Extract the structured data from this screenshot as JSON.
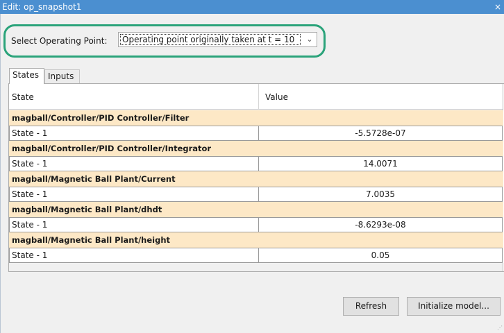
{
  "window": {
    "title": "Edit: op_snapshot1",
    "close_glyph": "×"
  },
  "operating_point": {
    "label": "Select Operating Point:",
    "selected": "Operating point originally taken at t = 10",
    "chevron": "⌄"
  },
  "tabs": [
    {
      "label": "States",
      "active": true
    },
    {
      "label": "Inputs",
      "active": false
    }
  ],
  "table": {
    "columns": [
      "State",
      "Value"
    ],
    "groups": [
      {
        "name": "magball/Controller/PID Controller/Filter",
        "state": "State - 1",
        "value": "-5.5728e-07"
      },
      {
        "name": "magball/Controller/PID Controller/Integrator",
        "state": "State - 1",
        "value": "14.0071"
      },
      {
        "name": "magball/Magnetic Ball Plant/Current",
        "state": "State - 1",
        "value": "7.0035"
      },
      {
        "name": "magball/Magnetic Ball Plant/dhdt",
        "state": "State - 1",
        "value": "-8.6293e-08"
      },
      {
        "name": "magball/Magnetic Ball Plant/height",
        "state": "State - 1",
        "value": "0.05"
      }
    ]
  },
  "buttons": {
    "refresh": "Refresh",
    "initialize": "Initialize model..."
  },
  "colors": {
    "titlebar": "#4b8fd0",
    "group_row": "#fde8c6",
    "highlight_ring": "#2aa37a"
  }
}
